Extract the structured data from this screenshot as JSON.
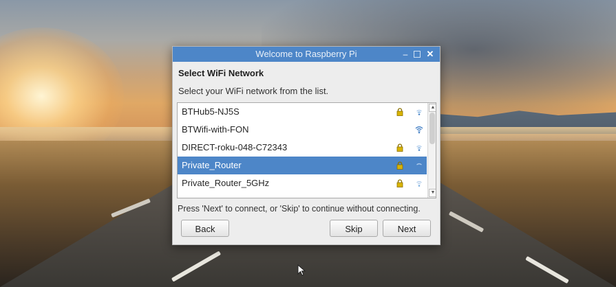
{
  "window": {
    "title": "Welcome to Raspberry Pi",
    "controls": {
      "minimize": "–",
      "close": "✕"
    }
  },
  "page": {
    "heading": "Select WiFi Network",
    "subtext": "Select your WiFi network from the list.",
    "hint": "Press 'Next' to connect, or 'Skip' to continue without connecting."
  },
  "networks": [
    {
      "ssid": "BTHub5-NJ5S",
      "secured": true,
      "selected": false,
      "signal_icon": "wifi-signal-weak-icon"
    },
    {
      "ssid": "BTWifi-with-FON",
      "secured": false,
      "selected": false,
      "signal_icon": "wifi-signal-strong-icon"
    },
    {
      "ssid": "DIRECT-roku-048-C72343",
      "secured": true,
      "selected": false,
      "signal_icon": "wifi-signal-weak-icon"
    },
    {
      "ssid": "Private_Router",
      "secured": true,
      "selected": true,
      "signal_icon": "wifi-signal-weak-icon"
    },
    {
      "ssid": "Private_Router_5GHz",
      "secured": true,
      "selected": false,
      "signal_icon": "wifi-signal-weak-icon"
    }
  ],
  "buttons": {
    "back": "Back",
    "skip": "Skip",
    "next": "Next"
  },
  "colors": {
    "titlebar": "#4d86c8",
    "selection": "#4d86c8",
    "lock": "#d9b400",
    "wifi": "#4d86c8"
  }
}
